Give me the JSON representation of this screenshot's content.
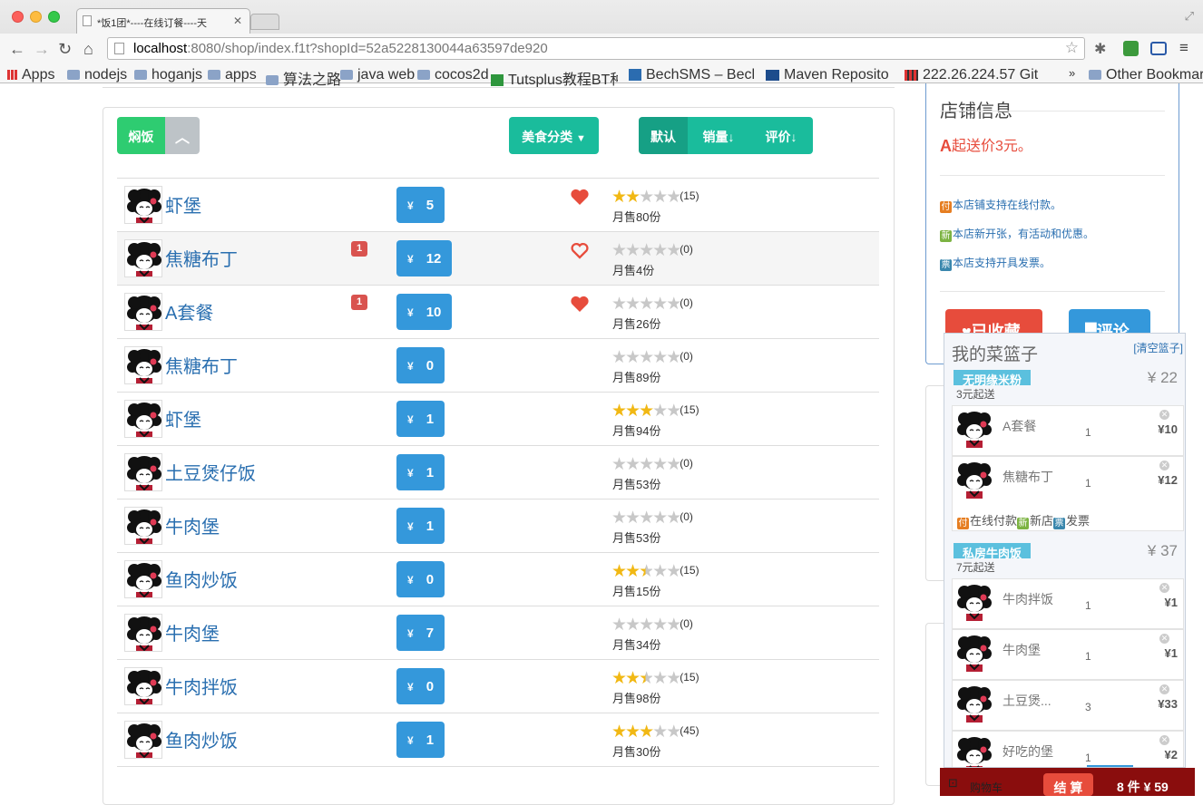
{
  "browser": {
    "tab_title": "*饭1团*----在线订餐----天",
    "url_host": "localhost",
    "url_rest": ":8080/shop/index.f1t?shopId=52a5228130044a63597de920",
    "bookmarks": [
      "Apps",
      "nodejs",
      "hoganjs",
      "apps",
      "算法之路",
      "java web",
      "cocos2d",
      "Tutsplus教程BT种子",
      "BechSMS – BechTech",
      "Maven Repository: S",
      "222.26.224.57 Git"
    ],
    "bookmark_more": "»",
    "other_bookmarks": "Other Bookmarks"
  },
  "filters": {
    "category_tag": "焖饭",
    "category_toggle_icon": "chevron-up-icon",
    "food_category": "美食分类",
    "sort_default": "默认",
    "sort_sales": "销量",
    "sort_rating": "评价"
  },
  "colors": {
    "green": "#2ecc71",
    "teal": "#1abc9c",
    "blue": "#3498db",
    "red_badge": "#d9534f",
    "star": "#f1b814",
    "heart": "#e74c3c"
  },
  "menu": [
    {
      "name": "虾堡",
      "badge": "",
      "price": "5",
      "liked": true,
      "rating": 2,
      "reviews": "(15)",
      "sold": "月售80份"
    },
    {
      "name": "焦糖布丁",
      "badge": "1",
      "price": "12",
      "liked": false,
      "rating": 0,
      "reviews": "(0)",
      "sold": "月售4份"
    },
    {
      "name": "A套餐",
      "badge": "1",
      "price": "10",
      "liked": true,
      "rating": 0,
      "reviews": "(0)",
      "sold": "月售26份"
    },
    {
      "name": "焦糖布丁",
      "badge": "",
      "price": "0",
      "liked": null,
      "rating": 0,
      "reviews": "(0)",
      "sold": "月售89份"
    },
    {
      "name": "虾堡",
      "badge": "",
      "price": "1",
      "liked": null,
      "rating": 3,
      "reviews": "(15)",
      "sold": "月售94份"
    },
    {
      "name": "土豆煲仔饭",
      "badge": "",
      "price": "1",
      "liked": null,
      "rating": 0,
      "reviews": "(0)",
      "sold": "月售53份"
    },
    {
      "name": "牛肉堡",
      "badge": "",
      "price": "1",
      "liked": null,
      "rating": 0,
      "reviews": "(0)",
      "sold": "月售53份"
    },
    {
      "name": "鱼肉炒饭",
      "badge": "",
      "price": "0",
      "liked": null,
      "rating": 2.5,
      "reviews": "(15)",
      "sold": "月售15份"
    },
    {
      "name": "牛肉堡",
      "badge": "",
      "price": "7",
      "liked": null,
      "rating": 0,
      "reviews": "(0)",
      "sold": "月售34份"
    },
    {
      "name": "牛肉拌饭",
      "badge": "",
      "price": "0",
      "liked": null,
      "rating": 2.5,
      "reviews": "(15)",
      "sold": "月售98份"
    },
    {
      "name": "鱼肉炒饭",
      "badge": "",
      "price": "1",
      "liked": null,
      "rating": 3,
      "reviews": "(45)",
      "sold": "月售30份"
    }
  ],
  "currency": "¥",
  "shop": {
    "title": "店铺信息",
    "min_order": "起送价3元。",
    "features": [
      {
        "icon": "付",
        "color": "#e67e22",
        "text": "本店铺支持在线付款。"
      },
      {
        "icon": "新",
        "color": "#7cb342",
        "text": "本店新开张，有活动和优惠。"
      },
      {
        "icon": "票",
        "color": "#3a87ad",
        "text": "本店支持开具发票。"
      }
    ],
    "favorited_label": "已收藏",
    "comment_label": "评论"
  },
  "cart": {
    "title": "我的菜篮子",
    "clear": "[清空篮子]",
    "groups": [
      {
        "shop": "无明缘米粉",
        "total": "¥ 22",
        "min": "3元起送",
        "items": [
          {
            "name": "A套餐",
            "qty": "1",
            "price": "¥10"
          },
          {
            "name": "焦糖布丁",
            "qty": "1",
            "price": "¥12"
          }
        ],
        "tags": [
          {
            "icon": "付",
            "color": "#e67e22",
            "text": "在线付款"
          },
          {
            "icon": "新",
            "color": "#7cb342",
            "text": "新店"
          },
          {
            "icon": "票",
            "color": "#3a87ad",
            "text": "发票"
          }
        ]
      },
      {
        "shop": "私房牛肉饭",
        "total": "¥ 37",
        "min": "7元起送",
        "items": [
          {
            "name": "牛肉拌饭",
            "qty": "1",
            "price": "¥1"
          },
          {
            "name": "牛肉堡",
            "qty": "1",
            "price": "¥1"
          },
          {
            "name": "土豆煲...",
            "qty": "3",
            "price": "¥33"
          },
          {
            "name": "好吃的堡",
            "qty": "1",
            "price": "¥2"
          }
        ]
      }
    ],
    "bar_label": "购物车",
    "checkout": "结 算",
    "summary": "8 件 ¥ 59"
  }
}
